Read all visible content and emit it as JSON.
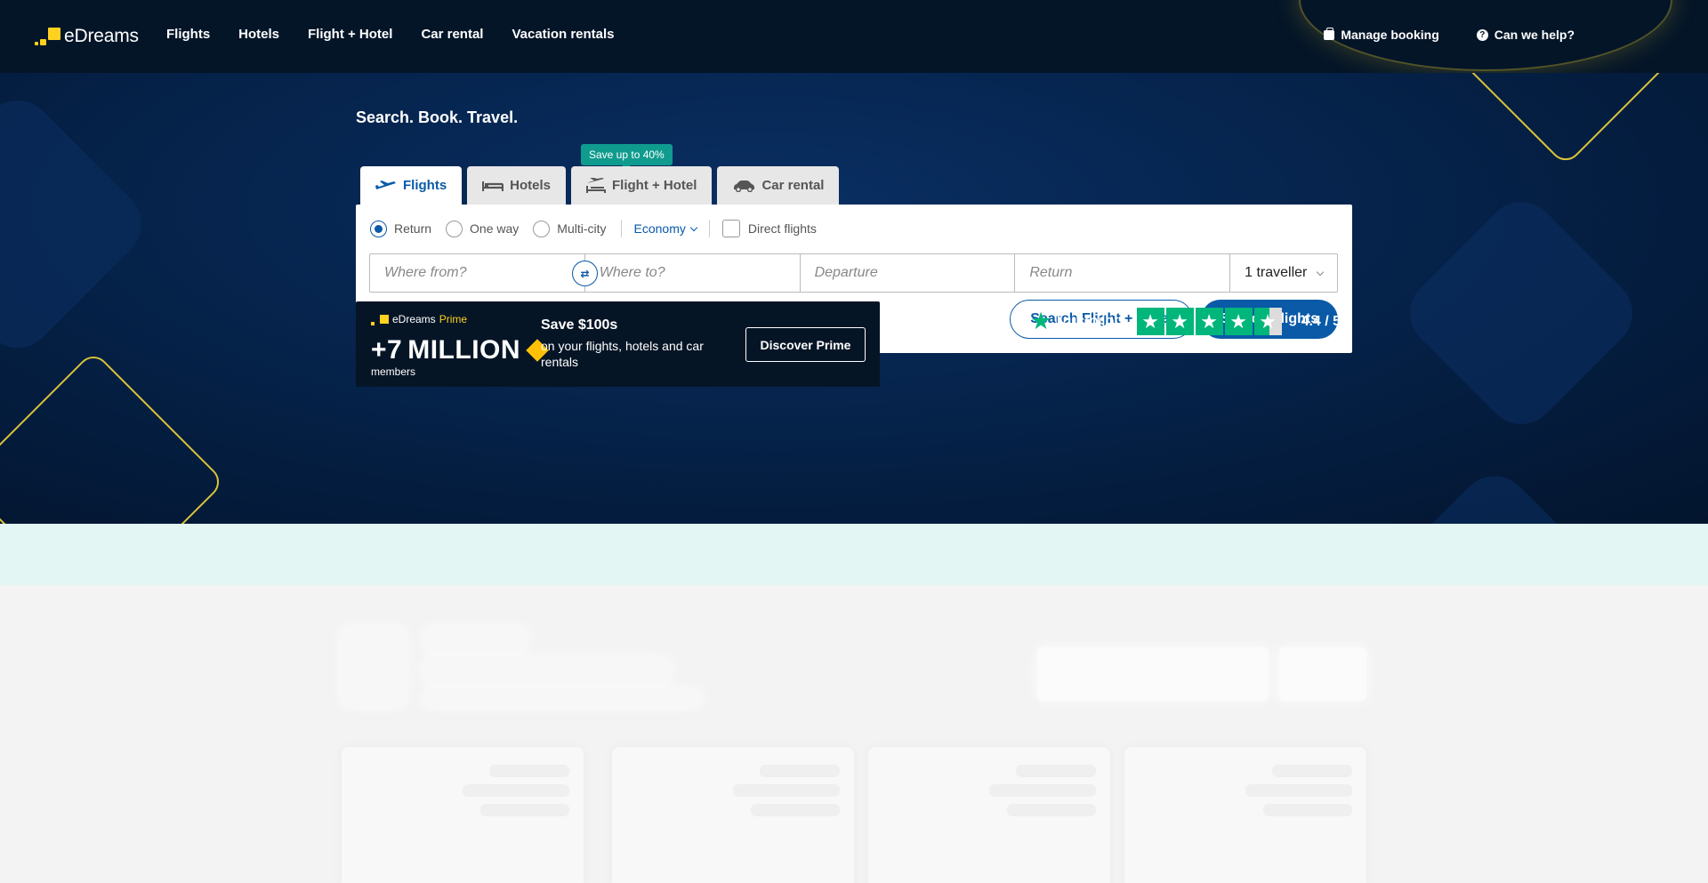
{
  "header": {
    "logo_text": "eDreams",
    "nav": [
      "Flights",
      "Hotels",
      "Flight + Hotel",
      "Car rental",
      "Vacation rentals"
    ],
    "manage_booking": "Manage booking",
    "help": "Can we help?"
  },
  "hero": {
    "tagline": "Search. Book. Travel.",
    "promo_pill": "Save up to 40%",
    "tabs": [
      {
        "label": "Flights",
        "icon": "plane-icon",
        "active": true
      },
      {
        "label": "Hotels",
        "icon": "bed-icon",
        "active": false
      },
      {
        "label": "Flight + Hotel",
        "icon": "plane-bed-icon",
        "active": false
      },
      {
        "label": "Car rental",
        "icon": "car-icon",
        "active": false
      }
    ]
  },
  "search": {
    "trip_types": [
      "Return",
      "One way",
      "Multi-city"
    ],
    "selected_trip": "Return",
    "cabin": "Economy",
    "direct_flights_label": "Direct flights",
    "direct_flights_checked": false,
    "from_placeholder": "Where from?",
    "to_placeholder": "Where to?",
    "departure_placeholder": "Departure",
    "return_placeholder": "Return",
    "travellers": "1 traveller",
    "search_flight_hotel": "Search Flight + Hotel",
    "search_flights": "Search Flights"
  },
  "prime": {
    "brand_main": "eDreams",
    "brand_accent": "Prime",
    "count_prefix": "+7",
    "count_word": "MILLION",
    "members": "members",
    "save_title": "Save $100s",
    "save_sub": "on your flights, hotels and car rentals",
    "button": "Discover Prime"
  },
  "trustpilot": {
    "name": "Trustpilot",
    "score": "4.4 / 5",
    "rating": 4.4
  },
  "colors": {
    "accent": "#0a5aa8",
    "header_bg": "#041528",
    "trustpilot_green": "#00b67a",
    "prime_yellow": "#ffd21f"
  }
}
